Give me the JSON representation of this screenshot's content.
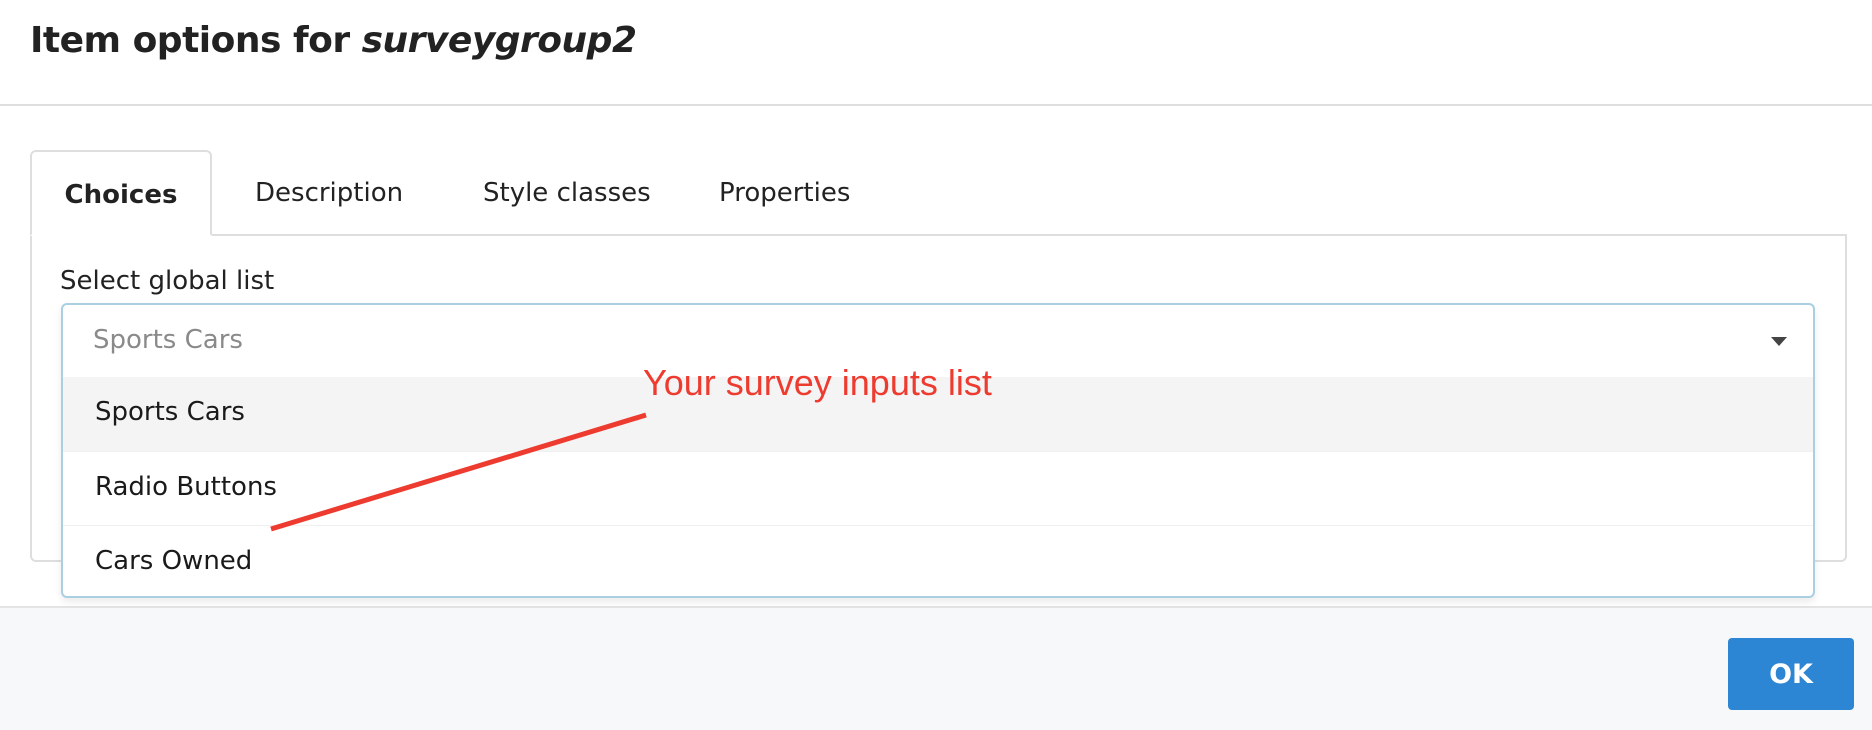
{
  "dialog": {
    "title_prefix": "Item options for ",
    "title_object": "surveygroup2"
  },
  "tabs": [
    {
      "label": "Choices",
      "active": true
    },
    {
      "label": "Description",
      "active": false
    },
    {
      "label": "Style classes",
      "active": false
    },
    {
      "label": "Properties",
      "active": false
    }
  ],
  "choices": {
    "field_label": "Select global list",
    "selected_value": "Sports Cars",
    "options": [
      {
        "label": "Sports Cars",
        "highlighted": true
      },
      {
        "label": "Radio Buttons",
        "highlighted": false
      },
      {
        "label": "Cars Owned",
        "highlighted": false
      }
    ]
  },
  "footer": {
    "ok_label": "OK"
  },
  "annotation": {
    "text": "Your survey inputs list",
    "color": "#ee3b30"
  },
  "colors": {
    "primary_button": "#2d86d3",
    "select_border": "#a9cfe0",
    "highlight_row": "#f4f4f4"
  }
}
